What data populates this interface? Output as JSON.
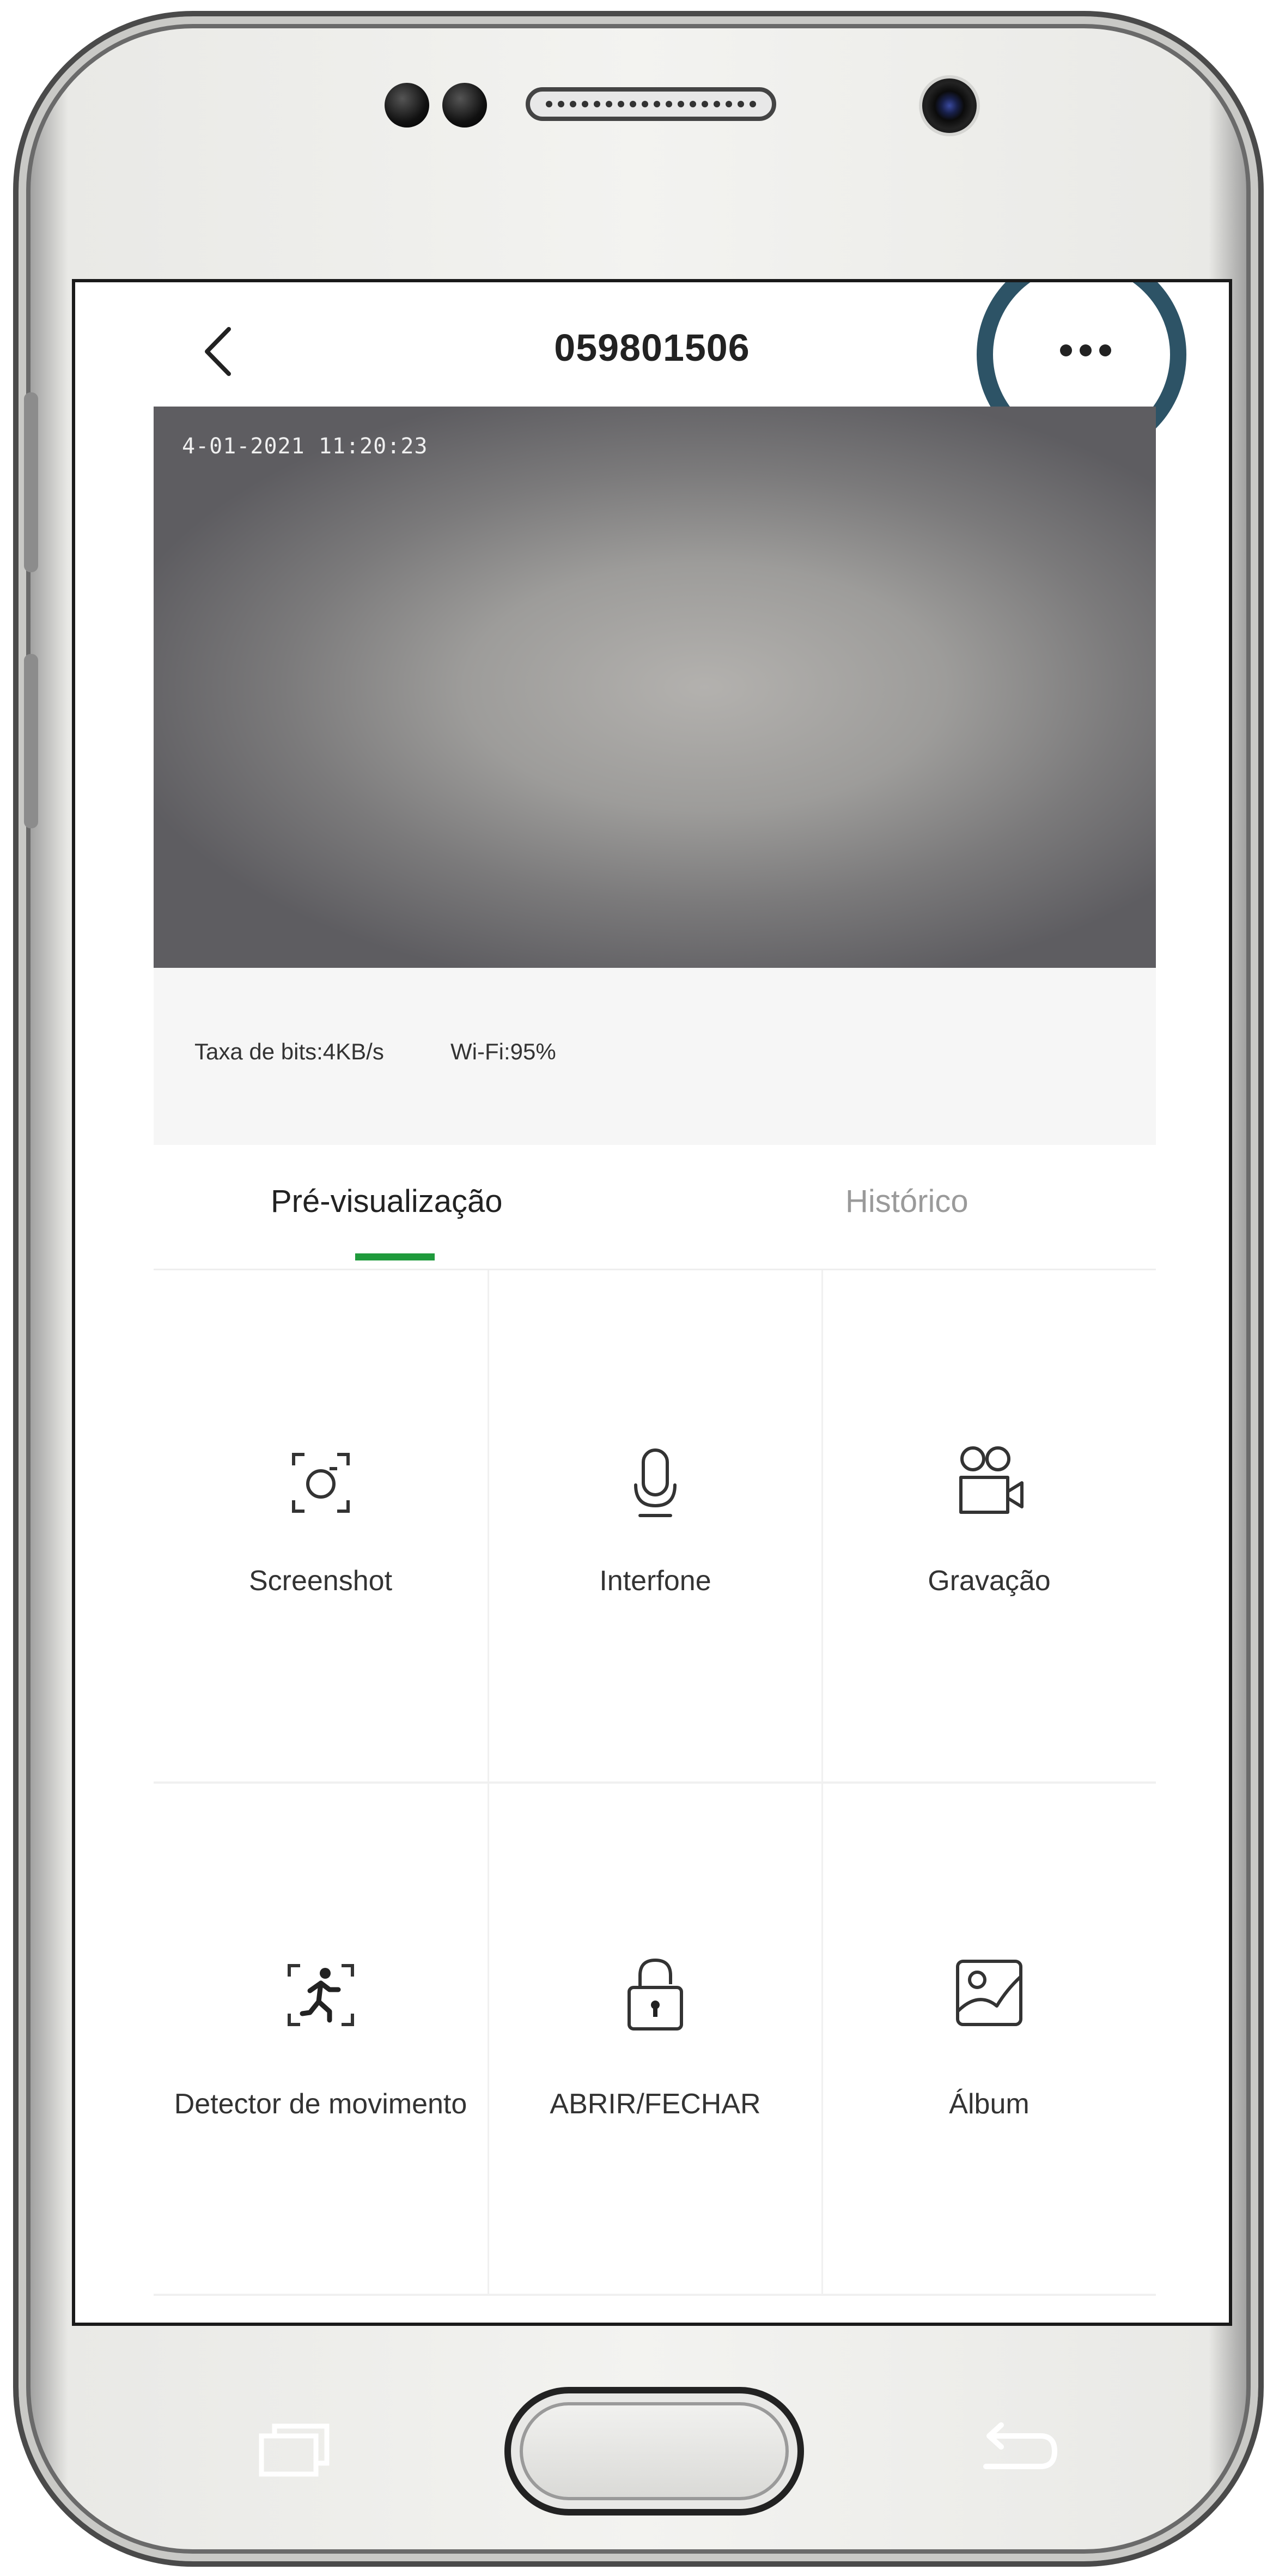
{
  "device": {
    "buttons": {
      "recent_apps": "recent-apps-icon",
      "home": "home-button",
      "back": "back-arrow-icon"
    }
  },
  "header": {
    "back_icon": "chevron-left-icon",
    "title": "059801506",
    "more_icon": "more-horizontal-icon",
    "highlight_color": "#2d5366"
  },
  "live_view": {
    "timestamp": "4-01-2021 11:20:23"
  },
  "stats": {
    "bitrate": "Taxa de bits:4KB/s",
    "wifi": "Wi-Fi:95%"
  },
  "tabs": [
    {
      "label": "Pré-visualização",
      "active": true
    },
    {
      "label": "Histórico",
      "active": false
    }
  ],
  "accent_color": "#1f9a3c",
  "actions": [
    {
      "label": "Screenshot",
      "icon": "screenshot-icon"
    },
    {
      "label": "Interfone",
      "icon": "microphone-icon"
    },
    {
      "label": "Gravação",
      "icon": "video-recording-icon"
    },
    {
      "label": "Detector de movimento",
      "icon": "motion-detector-icon"
    },
    {
      "label": "ABRIR/FECHAR",
      "icon": "lock-icon"
    },
    {
      "label": "Álbum",
      "icon": "album-icon"
    }
  ]
}
